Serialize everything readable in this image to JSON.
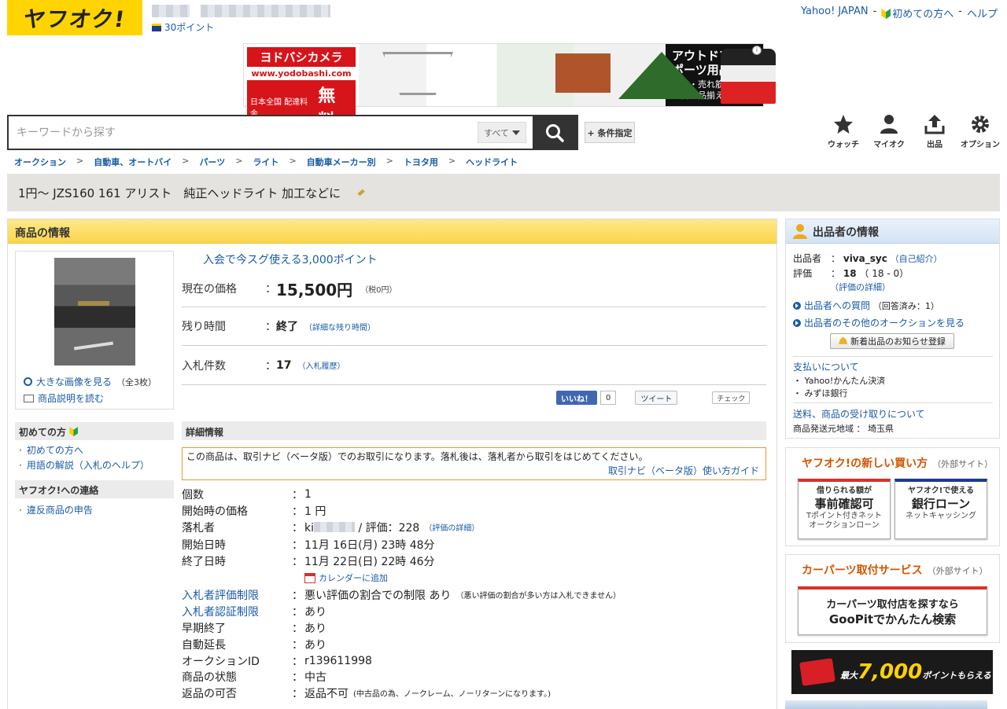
{
  "header": {
    "logo_text": "ヤフオク!",
    "points": "30ポイント",
    "top_links": [
      "Yahoo! JAPAN",
      "初めての方へ",
      "ヘルプ"
    ],
    "separator": "-"
  },
  "banner": {
    "brand": "ヨドバシカメラ",
    "url": "www.yodobashi.com",
    "free_label": "日本全国 配達料金",
    "free_word": "無料",
    "headline": "アウトドア・スポーツ用品",
    "subline": "人気・売れ筋商品を豊富に品揃え"
  },
  "search": {
    "placeholder": "キーワードから探す",
    "category": "すべて",
    "conditions": "+ 条件指定"
  },
  "nav_icons": [
    "ウォッチ",
    "マイオク",
    "出品",
    "オプション"
  ],
  "breadcrumb": [
    "オークション",
    "自動車、オートバイ",
    "パーツ",
    "ライト",
    "自動車メーカー別",
    "トヨタ用",
    "ヘッドライト"
  ],
  "breadcrumb_sep": ">",
  "title": "1円～ JZS160 161 アリスト　純正ヘッドライト 加工などに",
  "item_info": {
    "heading": "商品の情報",
    "promo": "入会で今スグ使える3,000ポイント",
    "price_label": "現在の価格",
    "price": "15,500円",
    "tax": "（税0円）",
    "time_label": "残り時間",
    "time_value": "終了",
    "time_link": "（詳細な残り時間）",
    "bids_label": "入札件数",
    "bids_value": "17",
    "bids_link": "（入札履歴）",
    "colon": "：",
    "image_link": "大きな画像を見る",
    "image_count": "（全3枚）",
    "desc_link": "商品説明を読む"
  },
  "social": {
    "like": "いいね！",
    "like_count": "0",
    "tweet": "ツイート",
    "check": "チェック"
  },
  "side": {
    "beginner_heading": "初めての方",
    "beginner_links": [
      "初めての方へ",
      "用語の解説（入札のヘルプ）"
    ],
    "contact_heading": "ヤフオク!への連絡",
    "contact_links": [
      "違反商品の申告"
    ]
  },
  "details": {
    "heading": "詳細情報",
    "notice": "この商品は、取引ナビ（ベータ版）でのお取引になります。落札後は、落札者から取引をはじめてください。",
    "notice_link": "取引ナビ（ベータ版）使い方ガイド",
    "calendar": "カレンダーに追加",
    "rows": [
      {
        "k": "個数",
        "v": "1"
      },
      {
        "k": "開始時の価格",
        "v": "1 円"
      },
      {
        "k": "落札者",
        "v_prefix": "ki",
        "v": " / 評価：228",
        "note": "（評価の詳細）"
      },
      {
        "k": "開始日時",
        "v": "11月 16日(月) 23時 48分"
      },
      {
        "k": "終了日時",
        "v": "11月 22日(日) 22時 46分"
      },
      {
        "k": "入札者評価制限",
        "v": "悪い評価の割合での制限 あり",
        "note": "（悪い評価の割合が多い方は入札できません）"
      },
      {
        "k": "入札者認証制限",
        "v": "あり"
      },
      {
        "k": "早期終了",
        "v": "あり"
      },
      {
        "k": "自動延長",
        "v": "あり"
      },
      {
        "k": "オークションID",
        "v": "r139611998"
      },
      {
        "k": "商品の状態",
        "v": "中古"
      },
      {
        "k": "返品の可否",
        "v": "返品不可",
        "note": "(中古品の為、ノークレーム、ノーリターンになります。)"
      }
    ]
  },
  "seller": {
    "heading": "出品者の情報",
    "seller_label": "出品者",
    "seller_name": "viva_syc",
    "self_intro": "（自己紹介）",
    "rating_label": "評価",
    "rating_value": "18",
    "rating_breakdown": "（ 18 - 0）",
    "rating_detail": "（評価の詳細）",
    "question_link": "出品者への質問",
    "question_count": "（回答済み：1）",
    "other_link": "出品者のその他のオークションを見る",
    "notify_button": "新着出品のお知らせ登録",
    "payment_link": "支払いについて",
    "payment_methods": [
      "Yahoo!かんたん決済",
      "みずほ銀行"
    ],
    "shipping_link": "送料、商品の受け取りについて",
    "ship_from_label": "商品発送元地域",
    "ship_from": "埼玉県"
  },
  "new_way": {
    "title": "ヤフオク!の新しい買い方",
    "external": "（外部サイト）",
    "card1": {
      "l1": "借りられる額が",
      "l2": "事前確認可",
      "l3a": "Tポイント付きネット",
      "l3b": "オークションローン"
    },
    "card2": {
      "l1": "ヤフオク!で使える",
      "l2": "銀行ローン",
      "l3a": "ネットキャッシング"
    }
  },
  "carparts": {
    "title": "カーパーツ取付サービス",
    "external": "（外部サイト）",
    "line1": "カーパーツ取付店を探すなら",
    "line2": "GooPitでかんたん検索"
  },
  "tpoint_ad": {
    "prefix": "最大",
    "amount": "7,000",
    "suffix": "ポイントもらえる"
  }
}
